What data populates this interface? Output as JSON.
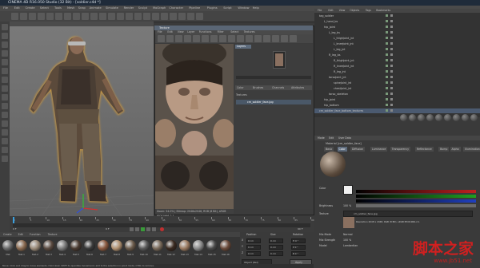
{
  "window": {
    "title": "CINEMA 4D R16.050 Studio (32 Bit) - [soldier.c4d *]"
  },
  "menubar": {
    "items": [
      "File",
      "Edit",
      "Create",
      "Select",
      "Tools",
      "Mesh",
      "Snap",
      "Animate",
      "Simulate",
      "Render",
      "Sculpt",
      "MoGraph",
      "Character",
      "Pipeline",
      "Plugins",
      "Script",
      "Window",
      "Help"
    ]
  },
  "texture_window": {
    "title": "Texture",
    "menu": [
      "File",
      "Edit",
      "View",
      "Layer",
      "Functions",
      "Filter",
      "Select",
      "Textures"
    ],
    "status": "Zoom: 54.0% | Bitmap: 2048x2048, RGB (8 Bit), sRGB IEC61966-2.1",
    "panel_tab": "Layers",
    "side_labels": [
      "Color",
      "Brushes",
      "Channels",
      "Attributes"
    ],
    "sub_tab": "Textures",
    "layer_name": "cm_soldier_face.jpg"
  },
  "object_manager": {
    "menu": [
      "File",
      "Edit",
      "View",
      "Objects",
      "Tags",
      "Bookmarks"
    ],
    "rows": [
      {
        "label": "tag_soldier",
        "indent": 0
      },
      {
        "label": "L_hand_bs",
        "indent": 1
      },
      {
        "label": "hip_joint",
        "indent": 1
      },
      {
        "label": "L_leg_bs",
        "indent": 2
      },
      {
        "label": "L_thighJoint_jnt",
        "indent": 3
      },
      {
        "label": "L_kneeJoint_jnt",
        "indent": 3
      },
      {
        "label": "L_leg_jnt",
        "indent": 3
      },
      {
        "label": "R_leg_bs",
        "indent": 2
      },
      {
        "label": "R_thighJoint_jnt",
        "indent": 3
      },
      {
        "label": "R_kneeJoint_jnt",
        "indent": 3
      },
      {
        "label": "R_leg_jnt",
        "indent": 3
      },
      {
        "label": "torsoJoint_jnt",
        "indent": 2
      },
      {
        "label": "spineJoint_jnt",
        "indent": 3
      },
      {
        "label": "chestJoint_jnt",
        "indent": 3
      },
      {
        "label": "torso_skeleton",
        "indent": 2
      },
      {
        "label": "hip_joint",
        "indent": 1
      },
      {
        "label": "hip_bottom",
        "indent": 1
      },
      {
        "label": "cm_soldier_face_bottom_textures",
        "indent": 0
      }
    ]
  },
  "attribute_manager": {
    "menu": [
      "Mode",
      "Edit",
      "User Data"
    ],
    "header": "Material [cm_soldier_face]",
    "tabs": [
      "Basic",
      "Color",
      "Diffusion",
      "Luminance",
      "Transparency",
      "Reflectance",
      "Bump",
      "Alpha",
      "Illumination",
      "Editor"
    ],
    "active_tab": "Color",
    "fields": [
      "Color",
      "Brightness",
      "Texture",
      "Mix Mode",
      "Mix Strength",
      "Model"
    ],
    "texture_file": "cm_soldier_face.jpg",
    "texture_info": "Resolution 2048 x 2048, RGB (8 Bit), sRGB IEC61966-2.1",
    "mix_mode": "Normal",
    "mix_strength": "100 %",
    "brightness": "100 %",
    "model": "Lambertian"
  },
  "timeline": {
    "start": "0 F",
    "end": "90 F",
    "current": "0 F",
    "ticks": [
      "0",
      "5",
      "10",
      "15",
      "20",
      "25",
      "30",
      "35",
      "40",
      "45",
      "50",
      "55",
      "60",
      "65",
      "70",
      "75",
      "80",
      "85",
      "90"
    ]
  },
  "material_manager": {
    "menu": [
      "Create",
      "Edit",
      "Function",
      "Texture"
    ],
    "materials": [
      "Mat",
      "Mat.1",
      "Mat.2",
      "Mat.3",
      "Mat.4",
      "Mat.5",
      "Mat.6",
      "Mat.7",
      "Mat.8",
      "Mat.9",
      "Mat.10",
      "Mat.11",
      "Mat.12",
      "Mat.13",
      "Mat.14",
      "Mat.15",
      "Mat.16"
    ]
  },
  "coordinates": {
    "headers": [
      "Position",
      "Size",
      "Rotation"
    ],
    "rows": [
      {
        "axis": "X",
        "pos": "0 cm",
        "size": "0 cm",
        "rot": "H 0 °"
      },
      {
        "axis": "Y",
        "pos": "0 cm",
        "size": "0 cm",
        "rot": "P 0 °"
      },
      {
        "axis": "Z",
        "pos": "0 cm",
        "size": "0 cm",
        "rot": "B 0 °"
      }
    ],
    "mode": "Object (Rel)",
    "apply": "Apply"
  },
  "statusbar": {
    "text": "Move: Click and drag to move elements. Hold down SHIFT to quantize movement / add to the selection in point mode, CTRL to remove."
  },
  "watermark": {
    "line1": "脚本之家",
    "line2": "www.jb51.net"
  },
  "colors": {
    "accent": "#5d6b7c",
    "selection": "#4b5a70",
    "watermark": "#d02020"
  }
}
